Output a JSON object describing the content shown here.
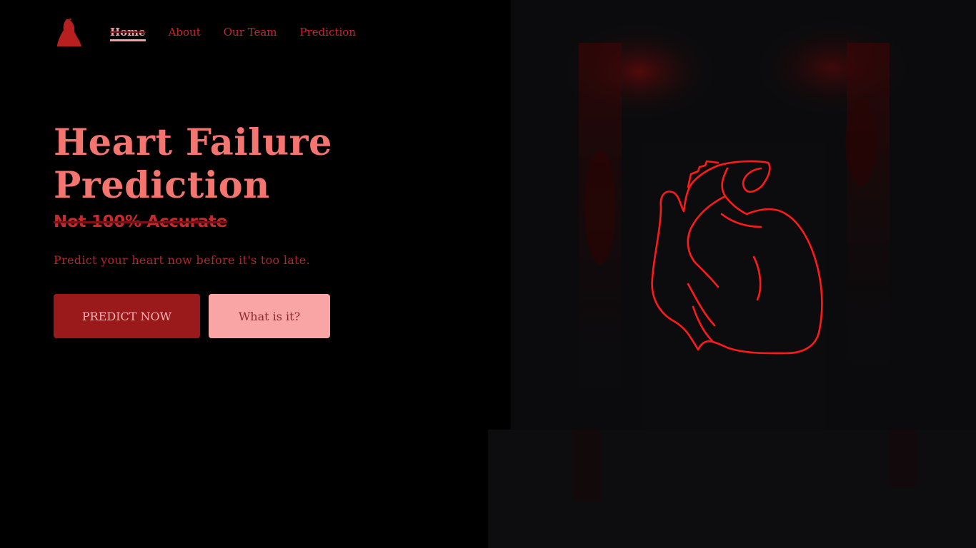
{
  "nav": {
    "logo_icon": "woman-silhouette-icon",
    "items": [
      {
        "label": "Home",
        "active": true
      },
      {
        "label": "About",
        "active": false
      },
      {
        "label": "Our Team",
        "active": false
      },
      {
        "label": "Prediction",
        "active": false
      }
    ]
  },
  "hero": {
    "title_line1": "Heart Failure",
    "title_line2": "Prediction",
    "subtitle": "Not 100% Accurate",
    "description": "Predict your heart now before it's too late.",
    "primary_button": "PREDICT NOW",
    "secondary_button": "What is it?"
  },
  "image": {
    "subject": "heart-outline-icon",
    "heart_color": "#ff1a1a"
  },
  "colors": {
    "accent": "#f4756f",
    "dark_red": "#9a1a1c",
    "pink": "#f9a5a6",
    "background": "#000000"
  }
}
